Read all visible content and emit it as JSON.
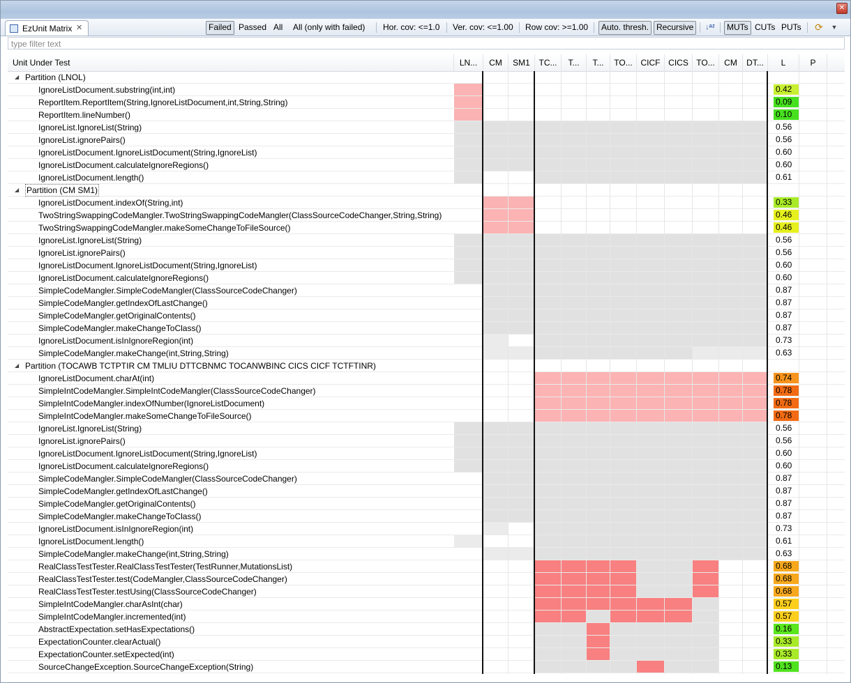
{
  "view": {
    "tab_label": "EzUnit Matrix",
    "filter_placeholder": "type filter text",
    "toolbar": {
      "failed": "Failed",
      "passed": "Passed",
      "all": "All",
      "all_failed": "All (only with failed)",
      "hor_cov": "Hor. cov: <=1.0",
      "ver_cov": "Ver. cov: <=1.00",
      "row_cov": "Row cov: >=1.00",
      "auto_thresh": "Auto. thresh.",
      "recursive": "Recursive",
      "muts": "MUTs",
      "cuts": "CUTs",
      "puts": "PUTs"
    }
  },
  "columns": [
    "LN...",
    "CM",
    "SM1",
    "TC...",
    "T...",
    "T...",
    "TO...",
    "CICF",
    "CICS",
    "TO...",
    "CM",
    "DT...",
    "L",
    "P"
  ],
  "name_header": "Unit Under Test",
  "colors": {
    "pink": "#fbb3b3",
    "red": "#f88080",
    "gray": "#e1e1e1",
    "lightgray": "#ebebeb"
  },
  "rows": [
    {
      "type": "partition",
      "name": "Partition (LNOL)"
    },
    {
      "type": "item",
      "name": "IgnoreListDocument.substring(int,int)",
      "cells": "P..............",
      "l": "0.42",
      "lc": "#c8f032"
    },
    {
      "type": "item",
      "name": "ReportItem.ReportItem(String,IgnoreListDocument,int,String,String)",
      "cells": "P..............",
      "l": "0.09",
      "lc": "#46e01e"
    },
    {
      "type": "item",
      "name": "ReportItem.lineNumber()",
      "cells": "P..............",
      "l": "0.10",
      "lc": "#46e01e"
    },
    {
      "type": "item",
      "name": "IgnoreList.IgnoreList(String)",
      "cells": "GGGGGGGGGGGG",
      "l": "0.56",
      "lc": ""
    },
    {
      "type": "item",
      "name": "IgnoreList.ignorePairs()",
      "cells": "GGGGGGGGGGGG",
      "l": "0.56",
      "lc": ""
    },
    {
      "type": "item",
      "name": "IgnoreListDocument.IgnoreListDocument(String,IgnoreList)",
      "cells": "GGGGGGGGGGGG",
      "l": "0.60",
      "lc": ""
    },
    {
      "type": "item",
      "name": "IgnoreListDocument.calculateIgnoreRegions()",
      "cells": "GGGGGGGGGGGG",
      "l": "0.60",
      "lc": ""
    },
    {
      "type": "item",
      "name": "IgnoreListDocument.length()",
      "cells": "G..GGGGGGGGG",
      "l": "0.61",
      "lc": ""
    },
    {
      "type": "partition",
      "name": "Partition (CM SM1)",
      "boxed": true
    },
    {
      "type": "item",
      "name": "IgnoreListDocument.indexOf(String,int)",
      "cells": ".PP.........",
      "l": "0.33",
      "lc": "#a8ea28"
    },
    {
      "type": "item",
      "name": "TwoStringSwappingCodeMangler.TwoStringSwappingCodeMangler(ClassSourceCodeChanger,String,String)",
      "cells": ".PP.........",
      "l": "0.46",
      "lc": "#e6f01e"
    },
    {
      "type": "item",
      "name": "TwoStringSwappingCodeMangler.makeSomeChangeToFileSource()",
      "cells": ".PP.........",
      "l": "0.46",
      "lc": "#e6f01e"
    },
    {
      "type": "item",
      "name": "IgnoreList.IgnoreList(String)",
      "cells": "GGGGGGGGGGGG",
      "l": "0.56",
      "lc": ""
    },
    {
      "type": "item",
      "name": "IgnoreList.ignorePairs()",
      "cells": "GGGGGGGGGGGG",
      "l": "0.56",
      "lc": ""
    },
    {
      "type": "item",
      "name": "IgnoreListDocument.IgnoreListDocument(String,IgnoreList)",
      "cells": "GGGGGGGGGGGG",
      "l": "0.60",
      "lc": ""
    },
    {
      "type": "item",
      "name": "IgnoreListDocument.calculateIgnoreRegions()",
      "cells": "GGGGGGGGGGGG",
      "l": "0.60",
      "lc": ""
    },
    {
      "type": "item",
      "name": "SimpleCodeMangler.SimpleCodeMangler(ClassSourceCodeChanger)",
      "cells": ".GGGGGGGGGGG",
      "l": "0.87",
      "lc": ""
    },
    {
      "type": "item",
      "name": "SimpleCodeMangler.getIndexOfLastChange()",
      "cells": ".GGGGGGGGGGG",
      "l": "0.87",
      "lc": ""
    },
    {
      "type": "item",
      "name": "SimpleCodeMangler.getOriginalContents()",
      "cells": ".GGGGGGGGGGG",
      "l": "0.87",
      "lc": ""
    },
    {
      "type": "item",
      "name": "SimpleCodeMangler.makeChangeToClass()",
      "cells": ".GGGGGGGGGGG",
      "l": "0.87",
      "lc": ""
    },
    {
      "type": "item",
      "name": "IgnoreListDocument.isInIgnoreRegion(int)",
      "cells": ".L.GGGGGGGGG",
      "l": "0.73",
      "lc": ""
    },
    {
      "type": "item",
      "name": "SimpleCodeMangler.makeChange(int,String,String)",
      "cells": ".LLGGGGGGLLL",
      "l": "0.63",
      "lc": ""
    },
    {
      "type": "partition",
      "name": "Partition (TOCAWB TCTPTIR CM TMLIU DTTCBNMC TOCANWBINC CICS CICF TCTFTINR)"
    },
    {
      "type": "item",
      "name": "IgnoreListDocument.charAt(int)",
      "cells": "...PPPPPPPPP",
      "l": "0.74",
      "lc": "#f7941d"
    },
    {
      "type": "item",
      "name": "SimpleIntCodeMangler.SimpleIntCodeMangler(ClassSourceCodeChanger)",
      "cells": "...PPPPPPPPP",
      "l": "0.78",
      "lc": "#f26b14"
    },
    {
      "type": "item",
      "name": "SimpleIntCodeMangler.indexOfNumber(IgnoreListDocument)",
      "cells": "...PPPPPPPPP",
      "l": "0.78",
      "lc": "#f26b14"
    },
    {
      "type": "item",
      "name": "SimpleIntCodeMangler.makeSomeChangeToFileSource()",
      "cells": "...PPPPPPPPP",
      "l": "0.78",
      "lc": "#f26b14"
    },
    {
      "type": "item",
      "name": "IgnoreList.IgnoreList(String)",
      "cells": "GGGGGGGGGGGG",
      "l": "0.56",
      "lc": ""
    },
    {
      "type": "item",
      "name": "IgnoreList.ignorePairs()",
      "cells": "GGGGGGGGGGGG",
      "l": "0.56",
      "lc": ""
    },
    {
      "type": "item",
      "name": "IgnoreListDocument.IgnoreListDocument(String,IgnoreList)",
      "cells": "GGGGGGGGGGGG",
      "l": "0.60",
      "lc": ""
    },
    {
      "type": "item",
      "name": "IgnoreListDocument.calculateIgnoreRegions()",
      "cells": "GGGGGGGGGGGG",
      "l": "0.60",
      "lc": ""
    },
    {
      "type": "item",
      "name": "SimpleCodeMangler.SimpleCodeMangler(ClassSourceCodeChanger)",
      "cells": ".GGGGGGGGGGG",
      "l": "0.87",
      "lc": ""
    },
    {
      "type": "item",
      "name": "SimpleCodeMangler.getIndexOfLastChange()",
      "cells": ".GGGGGGGGGGG",
      "l": "0.87",
      "lc": ""
    },
    {
      "type": "item",
      "name": "SimpleCodeMangler.getOriginalContents()",
      "cells": ".GGGGGGGGGGG",
      "l": "0.87",
      "lc": ""
    },
    {
      "type": "item",
      "name": "SimpleCodeMangler.makeChangeToClass()",
      "cells": ".GGGGGGGGGGG",
      "l": "0.87",
      "lc": ""
    },
    {
      "type": "item",
      "name": "IgnoreListDocument.isInIgnoreRegion(int)",
      "cells": ".L.GGGGGGGGG",
      "l": "0.73",
      "lc": ""
    },
    {
      "type": "item",
      "name": "IgnoreListDocument.length()",
      "cells": "L..GGGGGGGGG",
      "l": "0.61",
      "lc": ""
    },
    {
      "type": "item",
      "name": "SimpleCodeMangler.makeChange(int,String,String)",
      "cells": ".LLGGGGGGGGG",
      "l": "0.63",
      "lc": ""
    },
    {
      "type": "item",
      "name": "RealClassTestTester.RealClassTestTester(TestRunner,MutationsList)",
      "cells": "...RRRRGGR..",
      "l": "0.68",
      "lc": "#f7a81d"
    },
    {
      "type": "item",
      "name": "RealClassTestTester.test(CodeMangler,ClassSourceCodeChanger)",
      "cells": "...RRRRGGR..",
      "l": "0.68",
      "lc": "#f7a81d"
    },
    {
      "type": "item",
      "name": "RealClassTestTester.testUsing(ClassSourceCodeChanger)",
      "cells": "...RRRRGGR..",
      "l": "0.68",
      "lc": "#f7a81d"
    },
    {
      "type": "item",
      "name": "SimpleIntCodeMangler.charAsInt(char)",
      "cells": "...RRRRRRG..",
      "l": "0.57",
      "lc": "#fccf1e"
    },
    {
      "type": "item",
      "name": "SimpleIntCodeMangler.incremented(int)",
      "cells": "...RRGRRRG..",
      "l": "0.57",
      "lc": "#fccf1e"
    },
    {
      "type": "item",
      "name": "AbstractExpectation.setHasExpectations()",
      "cells": "...GGRGGGG..",
      "l": "0.16",
      "lc": "#5be61e"
    },
    {
      "type": "item",
      "name": "ExpectationCounter.clearActual()",
      "cells": "...GGRGGGG..",
      "l": "0.33",
      "lc": "#a8ea28"
    },
    {
      "type": "item",
      "name": "ExpectationCounter.setExpected(int)",
      "cells": "...GGRGGGG..",
      "l": "0.33",
      "lc": "#a8ea28"
    },
    {
      "type": "item",
      "name": "SourceChangeException.SourceChangeException(String)",
      "cells": "...GGGGRGG..",
      "l": "0.13",
      "lc": "#50e21e"
    }
  ]
}
